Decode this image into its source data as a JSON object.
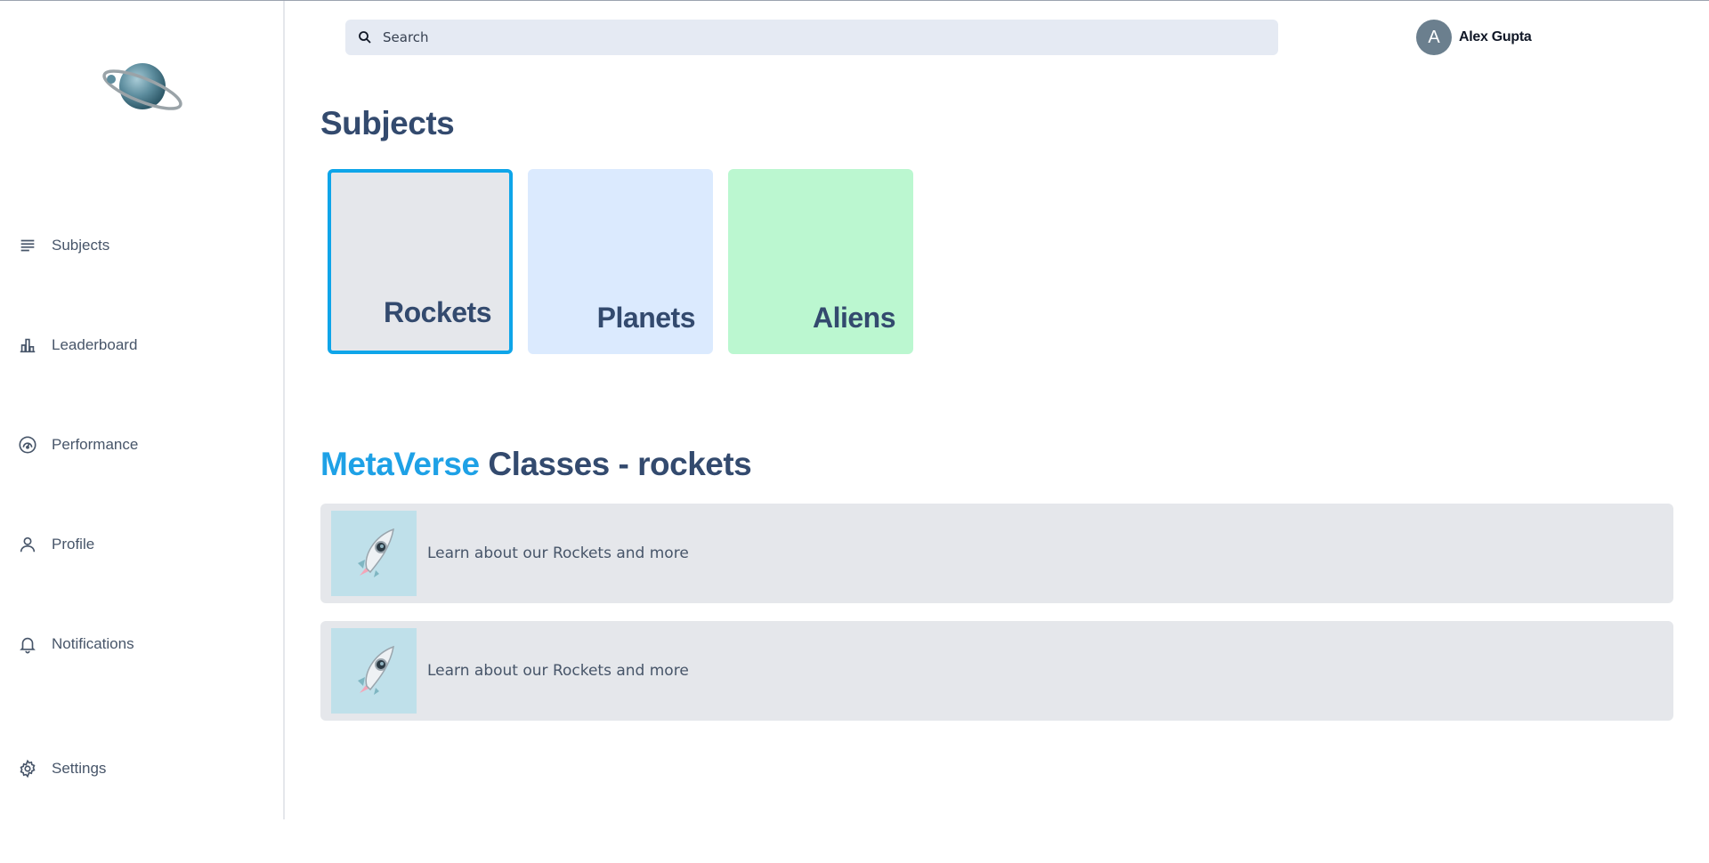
{
  "sidebar": {
    "items": [
      {
        "label": "Subjects",
        "icon": "list-icon"
      },
      {
        "label": "Leaderboard",
        "icon": "bar-chart-icon"
      },
      {
        "label": "Performance",
        "icon": "gauge-icon"
      },
      {
        "label": "Profile",
        "icon": "user-icon"
      },
      {
        "label": "Notifications",
        "icon": "bell-icon"
      },
      {
        "label": "Settings",
        "icon": "gear-icon"
      }
    ],
    "logo_icon": "planet-icon"
  },
  "header": {
    "search_placeholder": "Search",
    "user": {
      "initial": "A",
      "name": "Alex Gupta"
    }
  },
  "subjects": {
    "title": "Subjects",
    "cards": [
      {
        "label": "Rockets",
        "color": "#e5e7eb",
        "selected": true
      },
      {
        "label": "Planets",
        "color": "#dbeafe",
        "selected": false
      },
      {
        "label": "Aliens",
        "color": "#bbf7d0",
        "selected": false
      }
    ]
  },
  "classes": {
    "title_accent": "MetaVerse",
    "title_rest": " Classes - rockets",
    "items": [
      {
        "text": "Learn about our Rockets and more",
        "icon": "rocket-icon"
      },
      {
        "text": "Learn about our Rockets and more",
        "icon": "rocket-icon"
      }
    ]
  },
  "colors": {
    "accent": "#1ea1e6",
    "selected_border": "#0ea5e9",
    "heading": "#334a6e"
  }
}
